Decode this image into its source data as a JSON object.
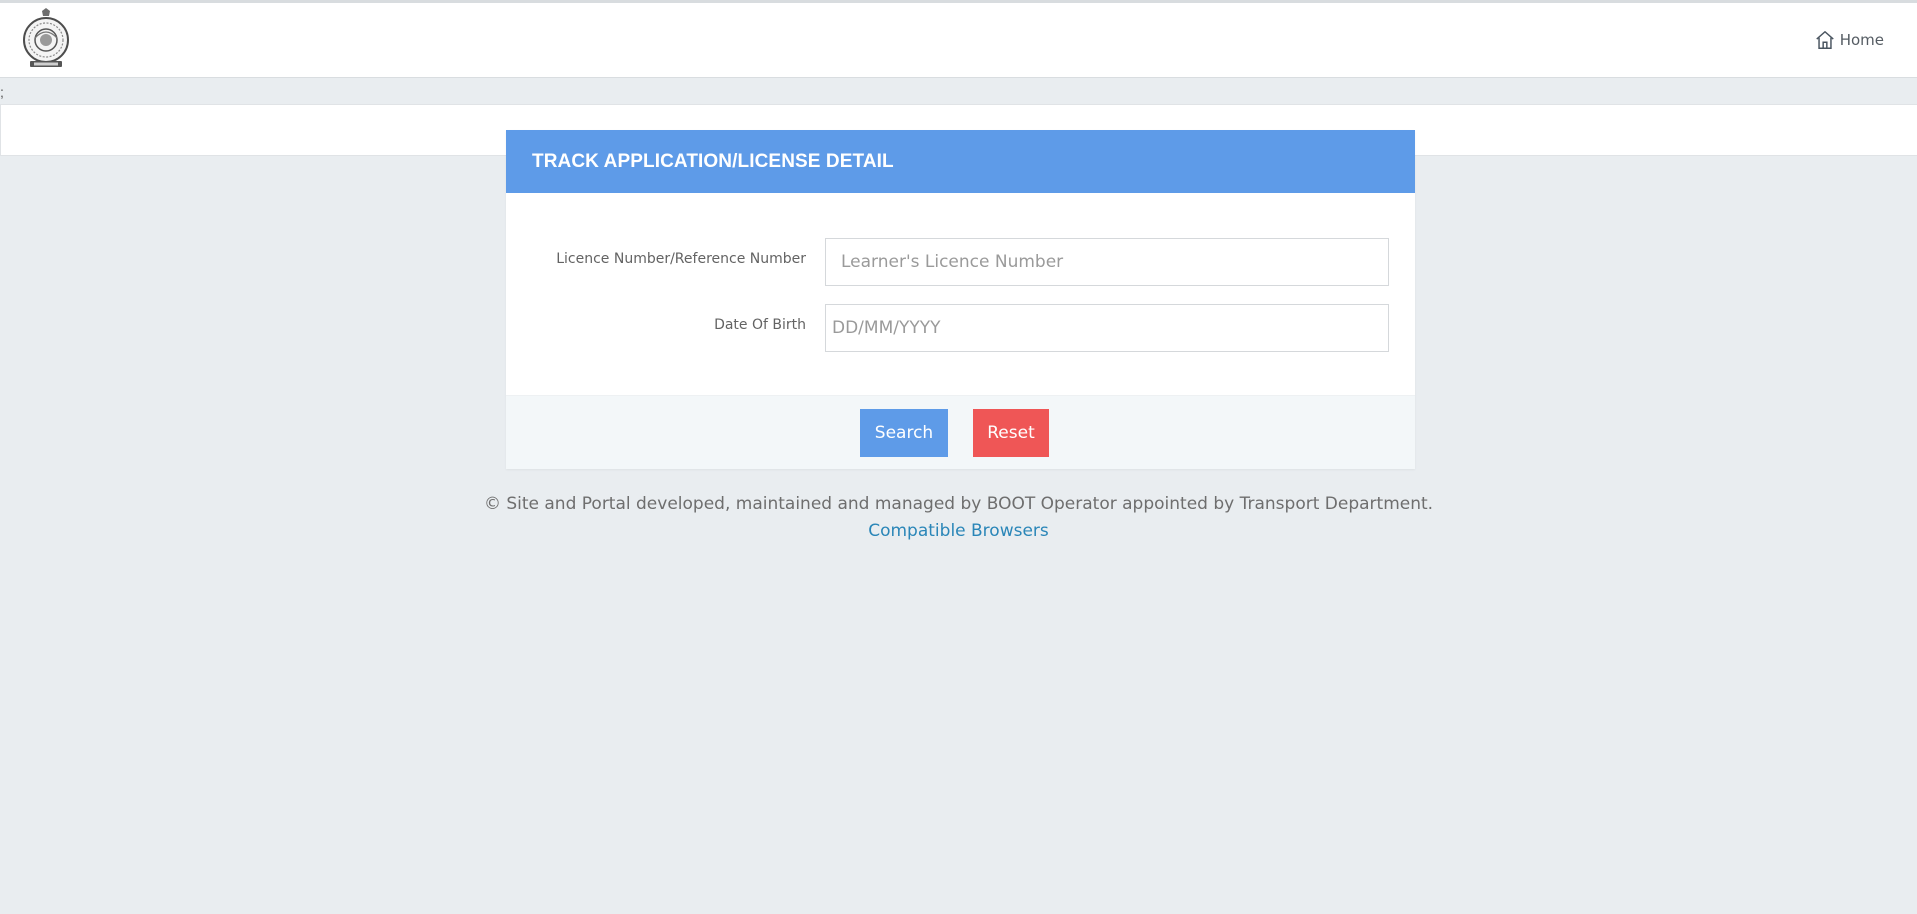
{
  "header": {
    "logo": "state-emblem",
    "home_label": "Home",
    "home_icon": "home-icon"
  },
  "stray_text": ";",
  "form": {
    "title": "TRACK APPLICATION/LICENSE DETAIL",
    "licence_label": "Licence Number/Reference Number",
    "licence_placeholder": "Learner's Licence Number",
    "licence_value": "",
    "dob_label": "Date Of Birth",
    "dob_placeholder": "DD/MM/YYYY",
    "dob_value": "",
    "search_label": "Search",
    "reset_label": "Reset"
  },
  "footer": {
    "copyright": "© Site and Portal developed, maintained and managed by BOOT Operator appointed by Transport Department.",
    "browsers_link": "Compatible Browsers"
  },
  "colors": {
    "panel_header": "#5e9be8",
    "search_button": "#5e9be8",
    "reset_button": "#ef5656",
    "link": "#2a86b8",
    "page_bg": "#e9edf0"
  }
}
